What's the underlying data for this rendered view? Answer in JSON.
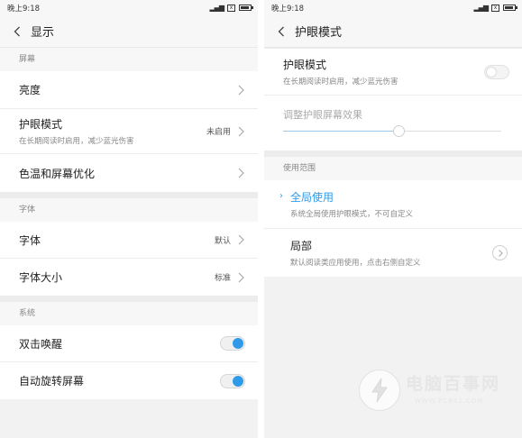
{
  "left": {
    "status": {
      "time": "晚上9:18",
      "sim_icon": "x"
    },
    "title": "显示",
    "sections": [
      {
        "header": "屏幕",
        "rows": [
          {
            "label": "亮度"
          },
          {
            "label": "护眼模式",
            "sub": "在长期阅读时启用，减少蓝光伤害",
            "value": "未启用"
          },
          {
            "label": "色温和屏幕优化"
          }
        ]
      },
      {
        "header": "字体",
        "rows": [
          {
            "label": "字体",
            "value": "默认"
          },
          {
            "label": "字体大小",
            "value": "标准"
          }
        ]
      },
      {
        "header": "系统",
        "rows": [
          {
            "label": "双击唤醒",
            "toggle": true
          },
          {
            "label": "自动旋转屏幕",
            "toggle": true
          }
        ]
      }
    ]
  },
  "right": {
    "status": {
      "time": "晚上9:18",
      "sim_icon": "x"
    },
    "title": "护眼模式",
    "eye_mode": {
      "label": "护眼模式",
      "sub": "在长期阅读时启用，减少蓝光伤害",
      "toggle": false
    },
    "slider": {
      "label": "调整护眼屏幕效果",
      "value": 0.53
    },
    "scope_header": "使用范围",
    "scope_options": [
      {
        "label": "全局使用",
        "sub": "系统全局使用护眼模式，不可自定义",
        "selected": true
      },
      {
        "label": "局部",
        "sub": "默认阅读类应用使用，点击右侧自定义",
        "selected": false
      }
    ]
  },
  "watermark": {
    "text": "电脑百事网",
    "url": "WWW.PC841.COM"
  },
  "colors": {
    "accent": "#2f9be8",
    "background": "#f2f2f2"
  },
  "icons": [
    "back-arrow-icon",
    "chevron-right-icon",
    "signal-icon",
    "battery-icon",
    "check-icon",
    "circle-arrow-icon"
  ]
}
